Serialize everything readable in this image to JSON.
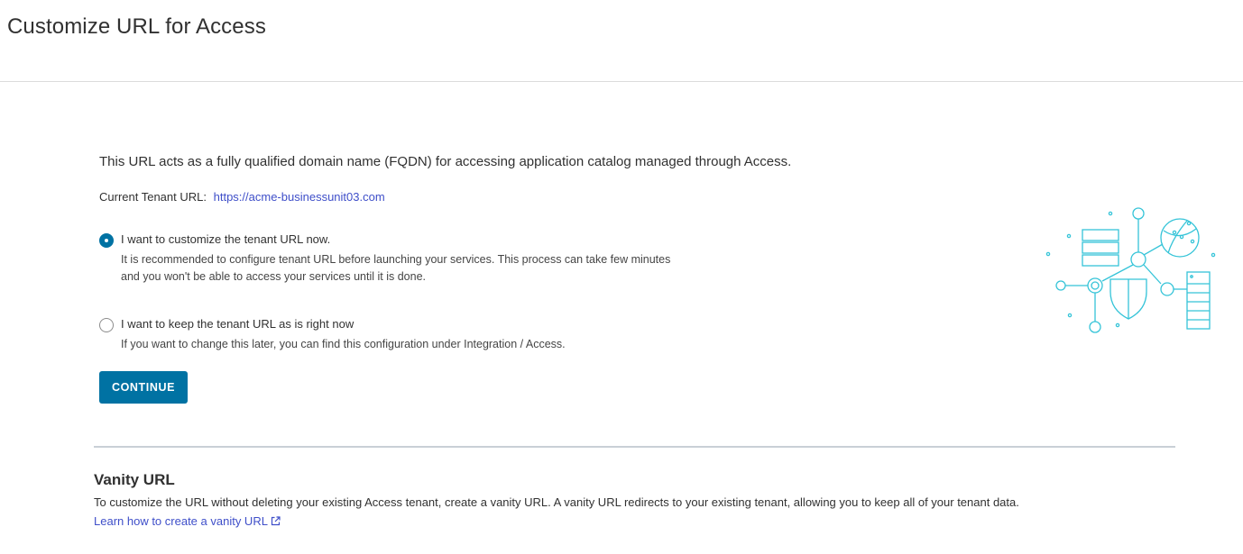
{
  "page": {
    "title": "Customize URL for Access"
  },
  "main": {
    "intro": "This URL acts as a fully qualified domain name (FQDN) for accessing application catalog managed through Access.",
    "tenant_label": "Current Tenant URL:",
    "tenant_url": "https://acme-businessunit03.com",
    "options": [
      {
        "label": "I want to customize the tenant URL now.",
        "description": "It is recommended to configure tenant URL before launching your services. This process can take few minutes and you won't be able to access your services until it is done.",
        "selected": true
      },
      {
        "label": "I want to keep the tenant URL as is right now",
        "description": "If you want to change this later, you can find this configuration under Integration / Access.",
        "selected": false
      }
    ],
    "continue_label": "CONTINUE"
  },
  "vanity": {
    "title": "Vanity URL",
    "description": "To customize the URL without deleting your existing Access tenant, create a vanity URL. A vanity URL redirects to your existing tenant, allowing you to keep all of your tenant data.",
    "learn_link": "Learn how to create a vanity URL"
  },
  "icons": {
    "illustration": "network-security-illustration",
    "external_link": "external-link-icon"
  },
  "colors": {
    "primary": "#0072a3",
    "link": "#3f4fc9",
    "illustration": "#35c4d8"
  }
}
